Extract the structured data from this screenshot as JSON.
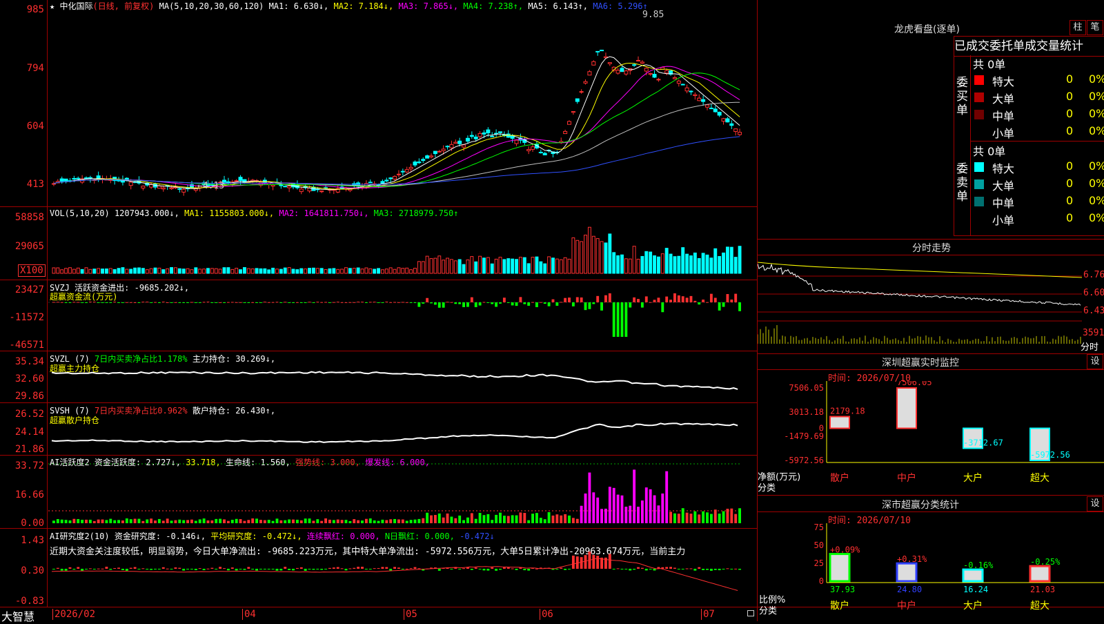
{
  "app": {
    "name": "大智慧"
  },
  "stock": {
    "star": "★",
    "name": "中化国际",
    "mode": "(日线, 前复权)"
  },
  "kline": {
    "ma_label": "MA(5,10,20,30,60,120)",
    "ma1": "MA1: 6.630↓,",
    "ma2": "MA2: 7.184↓,",
    "ma3": "MA3: 7.865↓,",
    "ma4": "MA4: 7.238↑,",
    "ma5": "MA5: 6.143↑,",
    "ma6": "MA6: 5.296↑",
    "yticks": [
      "985",
      "794",
      "604",
      "413"
    ],
    "high_mark": "9.85",
    "low_mark": "←4.13"
  },
  "vol": {
    "label": "VOL(5,10,20)",
    "value": "1207943.000↓,",
    "ma1": "MA1: 1155803.000↓,",
    "ma2": "MA2: 1641811.750↓,",
    "ma3": "MA3: 2718979.750↑",
    "yticks": [
      "58858",
      "29065"
    ],
    "unit": "X100"
  },
  "svzj": {
    "label": "SVZJ",
    "title": "活跃资金进出: -9685.202↓,",
    "subtitle": "超赢资金流(万元)",
    "yticks": [
      "23427",
      "-11572",
      "-46571"
    ]
  },
  "svzl": {
    "label": "SVZL (7)",
    "ratio": "7日内买卖净占比1.178%",
    "hold": "主力持仓: 30.269↓,",
    "subtitle": "超赢主力持仓",
    "yticks": [
      "35.34",
      "32.60",
      "29.86"
    ]
  },
  "svsh": {
    "label": "SVSH (7)",
    "ratio": "7日内买卖净占比0.962%",
    "hold": "散户持仓: 26.430↑,",
    "subtitle": "超赢散户持仓",
    "yticks": [
      "26.52",
      "24.14",
      "21.86"
    ]
  },
  "ai_active": {
    "label": "AI活跃度2",
    "v1": "资金活跃度: 2.727↓,",
    "v2": "33.718,",
    "v3": "生命线: 1.560,",
    "v4": "强势线: 3.000,",
    "v5": "爆发线: 6.000,",
    "yticks": [
      "33.72",
      "16.66",
      "0.00"
    ]
  },
  "ai_research": {
    "label": "AI研究度2(10)",
    "v1": "资金研究度: -0.146↓,",
    "v2": "平均研究度: -0.472↓,",
    "v3": "连续飘红: 0.000,",
    "v4": "N日飘红: 0.000,",
    "v5": "-0.472↓",
    "text": "近期大资金关注度较低，明显弱势，今日大单净流出: -9685.223万元，其中特大单净流出: -5972.556万元，大单5日累计净出-20963.674万元，当前主力",
    "yticks": [
      "1.43",
      "0.30",
      "-0.83"
    ]
  },
  "xaxis": {
    "labels": [
      "2026/02",
      "04",
      "05",
      "06",
      "07"
    ]
  },
  "dragon": {
    "title": "龙虎看盘(逐单)",
    "btn1": "柱",
    "btn2": "笔",
    "tabs": [
      "已成交",
      "委托单",
      "成交量",
      "统计"
    ],
    "buy": {
      "side": "委买单",
      "total": "共 0单",
      "rows": [
        {
          "label": "特大",
          "count": "0",
          "pct": "0%",
          "color": "#ff0000"
        },
        {
          "label": "大单",
          "count": "0",
          "pct": "0%",
          "color": "#b00000"
        },
        {
          "label": "中单",
          "count": "0",
          "pct": "0%",
          "color": "#700000"
        },
        {
          "label": "小单",
          "count": "0",
          "pct": "0%",
          "color": ""
        }
      ]
    },
    "sell": {
      "side": "委卖单",
      "total": "共 0单",
      "rows": [
        {
          "label": "特大",
          "count": "0",
          "pct": "0%",
          "color": "#00ffff"
        },
        {
          "label": "大单",
          "count": "0",
          "pct": "0%",
          "color": "#00a0a0"
        },
        {
          "label": "中单",
          "count": "0",
          "pct": "0%",
          "color": "#007070"
        },
        {
          "label": "小单",
          "count": "0",
          "pct": "0%",
          "color": ""
        }
      ]
    }
  },
  "intraday": {
    "title": "分时走势",
    "prices": [
      "6.76",
      "6.60",
      "6.43"
    ],
    "vol": "3591",
    "vol_label": "分时"
  },
  "monitor": {
    "title": "深圳超赢实时监控",
    "btn": "设",
    "time": "时间: 2026/07/10",
    "yticks": [
      "7506.05",
      "3013.18",
      "0",
      "-1479.69",
      "-5972.56"
    ],
    "ylabel1": "净额(万元)",
    "ylabel2": "分类",
    "chart_data": {
      "type": "bar",
      "categories": [
        "散户",
        "中户",
        "大户",
        "超大"
      ],
      "values": [
        2179.18,
        7506.05,
        -3712.67,
        -5972.56
      ],
      "labels": [
        "2179.18",
        "7506.05",
        "-3712.67",
        "-5972.56"
      ],
      "ylim": [
        -5972.56,
        7506.05
      ],
      "colors": [
        "#ff3030",
        "#ff3030",
        "#00ffff",
        "#00ffff"
      ]
    }
  },
  "classify": {
    "title": "深市超赢分类统计",
    "btn": "设",
    "time": "时间: 2026/07/10",
    "yticks": [
      "75",
      "50",
      "25",
      "0"
    ],
    "ylabel1": "比例%",
    "ylabel2": "分类",
    "chart_data": {
      "type": "bar",
      "categories": [
        "散户",
        "中户",
        "大户",
        "超大"
      ],
      "values": [
        37.93,
        24.8,
        16.24,
        21.03
      ],
      "changes": [
        "+0.09%",
        "+0.31%",
        "-0.16%",
        "-0.25%"
      ],
      "ylim": [
        0,
        75
      ],
      "colors": [
        "#00ff00",
        "#3040ff",
        "#00ffff",
        "#ff3030"
      ]
    }
  }
}
